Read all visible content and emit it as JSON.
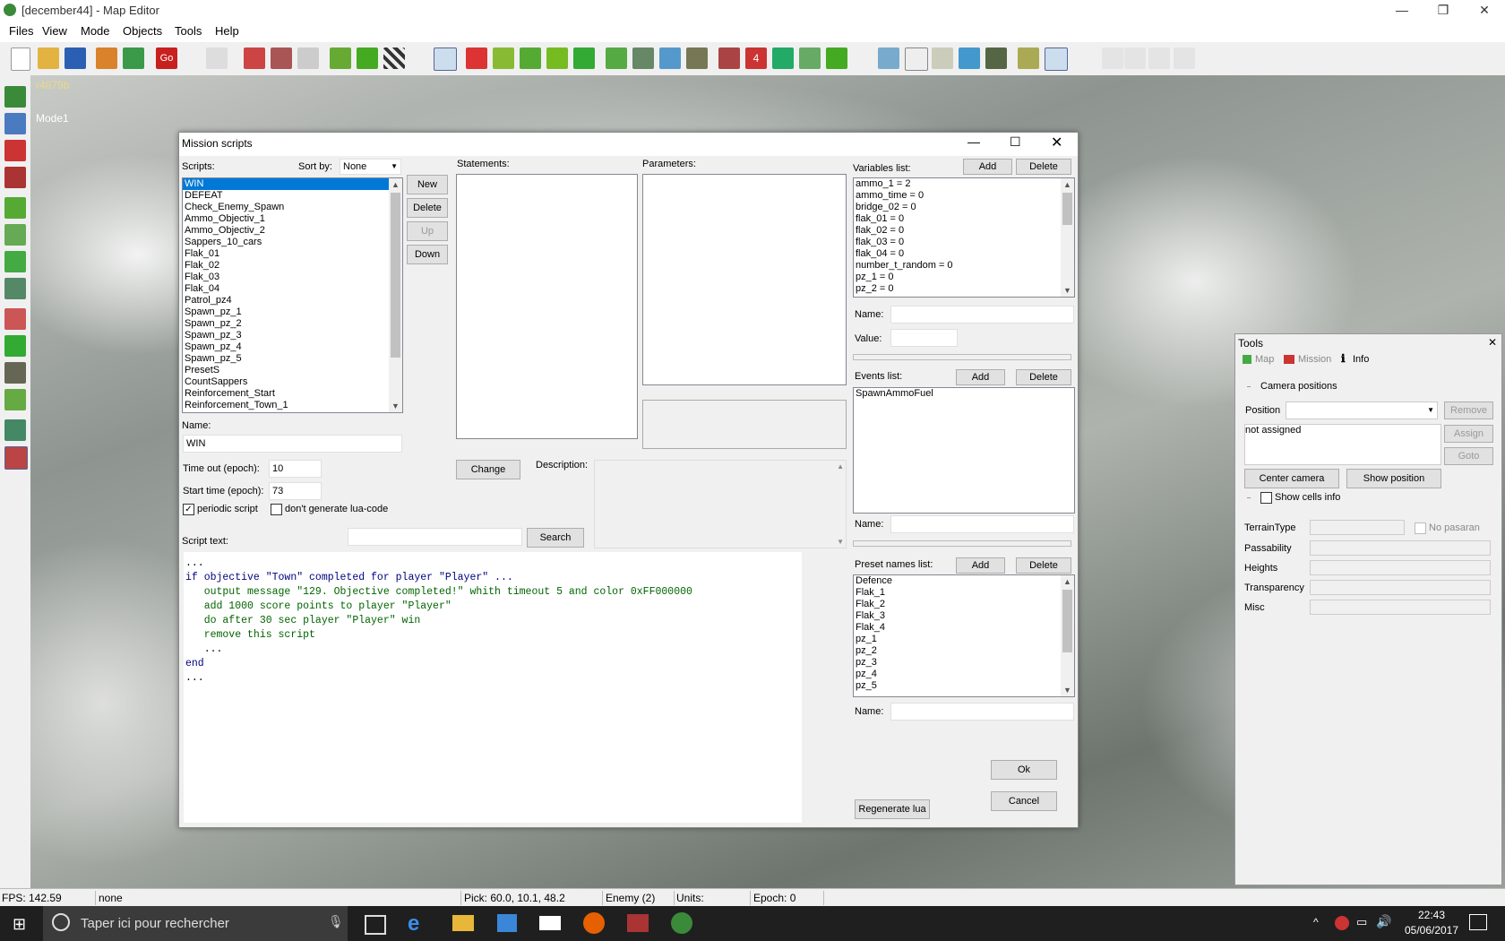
{
  "window": {
    "title": "[december44] - Map Editor"
  },
  "menu": [
    "Files",
    "View",
    "Mode",
    "Objects",
    "Tools",
    "Help"
  ],
  "viewport": {
    "label1": "r4879b",
    "label2": "Mode1"
  },
  "statusbar": {
    "fps": "FPS: 142.59",
    "sel": "none",
    "pick": "Pick: 60.0, 10.1, 48.2",
    "enemy": "Enemy (2)",
    "units": "Units:",
    "epoch": "Epoch: 0"
  },
  "taskbar": {
    "search_placeholder": "Taper ici pour rechercher",
    "time": "22:43",
    "date": "05/06/2017"
  },
  "dialog": {
    "title": "Mission scripts",
    "scripts_label": "Scripts:",
    "sortby_label": "Sort by:",
    "sortby_value": "None",
    "scripts": [
      "WIN",
      "DEFEAT",
      "Check_Enemy_Spawn",
      "Ammo_Objectiv_1",
      "Ammo_Objectiv_2",
      "Sappers_10_cars",
      "Flak_01",
      "Flak_02",
      "Flak_03",
      "Flak_04",
      "Patrol_pz4",
      "Spawn_pz_1",
      "Spawn_pz_2",
      "Spawn_pz_3",
      "Spawn_pz_4",
      "Spawn_pz_5",
      "PresetS",
      "CountSappers",
      "Reinforcement_Start",
      "Reinforcement_Town_1"
    ],
    "buttons": {
      "new": "New",
      "delete": "Delete",
      "up": "Up",
      "down": "Down",
      "change": "Change",
      "search": "Search",
      "ok": "Ok",
      "cancel": "Cancel",
      "regen": "Regenerate lua"
    },
    "statements_label": "Statements:",
    "parameters_label": "Parameters:",
    "name_label": "Name:",
    "name_value": "WIN",
    "timeout_label": "Time out (epoch):",
    "timeout_value": "10",
    "starttime_label": "Start time (epoch):",
    "starttime_value": "73",
    "periodic_label": "periodic script",
    "nolua_label": "don't generate lua-code",
    "description_label": "Description:",
    "scripttext_label": "Script text:",
    "script_lines": [
      "...",
      "if objective \"Town\" completed for player \"Player\" ...",
      "   output message \"129. Objective completed!\" whith timeout 5 and color 0xFF000000",
      "   add 1000 score points to player \"Player\"",
      "   do after 30 sec player \"Player\" win",
      "   remove this script",
      "   ...",
      "end",
      "..."
    ],
    "variables_label": "Variables list:",
    "variables": [
      "ammo_1 = 2",
      "ammo_time = 0",
      "bridge_02 = 0",
      "flak_01 = 0",
      "flak_02 = 0",
      "flak_03 = 0",
      "flak_04 = 0",
      "number_t_random = 0",
      "pz_1 = 0",
      "pz_2 = 0"
    ],
    "add_label": "Add",
    "delete_label": "Delete",
    "var_name_label": "Name:",
    "var_value_label": "Value:",
    "events_label": "Events list:",
    "events": [
      "SpawnAmmoFuel"
    ],
    "presets_label": "Preset names list:",
    "presets": [
      "Defence",
      "Flak_1",
      "Flak_2",
      "Flak_3",
      "Flak_4",
      "pz_1",
      "pz_2",
      "pz_3",
      "pz_4",
      "pz_5"
    ]
  },
  "tools": {
    "title": "Tools",
    "tabs": [
      "Map",
      "Mission",
      "Info"
    ],
    "camera_positions": "Camera positions",
    "position_label": "Position",
    "not_assigned": "not assigned",
    "remove": "Remove",
    "assign": "Assign",
    "goto": "Goto",
    "center_camera": "Center camera",
    "show_position": "Show position",
    "show_cells_info": "Show cells info",
    "terrain_type": "TerrainType",
    "no_pasaran": "No pasaran",
    "passability": "Passability",
    "heights": "Heights",
    "transparency": "Transparency",
    "misc": "Misc"
  },
  "colors": {
    "selection": "#0078d7",
    "keyword": "#000080",
    "action": "#006400"
  }
}
